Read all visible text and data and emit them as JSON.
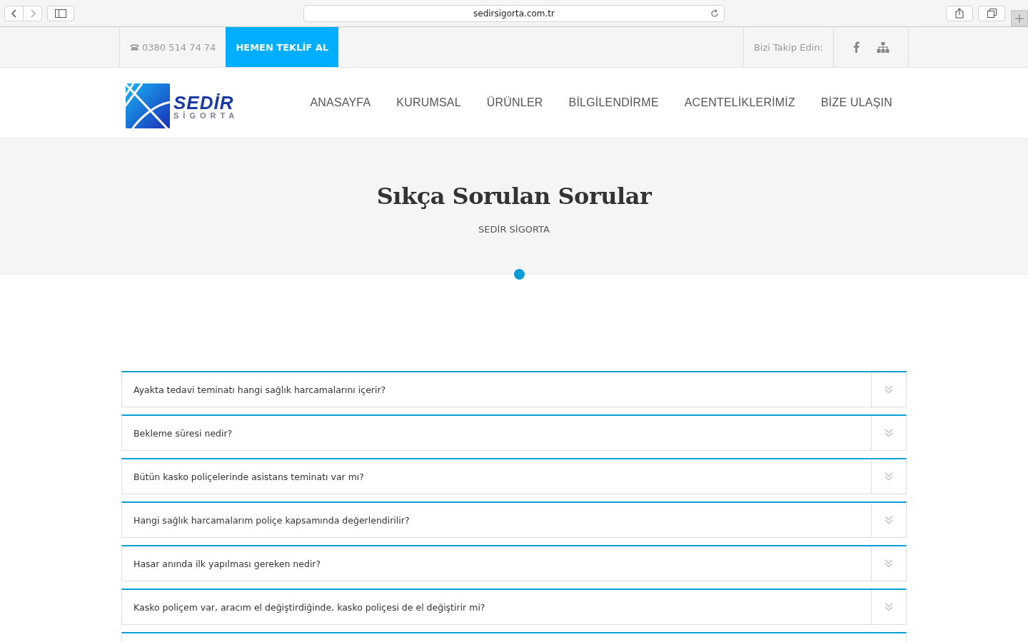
{
  "browser": {
    "url": "sedirsigorta.com.tr"
  },
  "topbar": {
    "phone": "0380 514 74 74",
    "cta": "HEMEN TEKLİF AL",
    "follow": "Bizi Takip Edin:"
  },
  "logo": {
    "name": "SEDİR",
    "tagline": "SİGORTA"
  },
  "nav": [
    {
      "label": "ANASAYFA"
    },
    {
      "label": "KURUMSAL"
    },
    {
      "label": "ÜRÜNLER"
    },
    {
      "label": "BİLGİLENDİRME"
    },
    {
      "label": "ACENTELİKLERİMİZ"
    },
    {
      "label": "BİZE ULAŞIN"
    }
  ],
  "hero": {
    "title": "Sıkça Sorulan Sorular",
    "subtitle": "SEDİR SİGORTA"
  },
  "faqs": [
    {
      "question": "Ayakta tedavi teminatı hangi sağlık harcamalarını içerir?",
      "expanded": false
    },
    {
      "question": "Bekleme süresi nedir?",
      "expanded": false
    },
    {
      "question": "Bütün kasko poliçelerinde asistans teminatı var mı?",
      "expanded": false
    },
    {
      "question": "Hangi sağlık harcamalarım poliçe kapsamında değerlendirilir?",
      "expanded": false
    },
    {
      "question": "Hasar anında ilk yapılması gereken nedir?",
      "expanded": false
    },
    {
      "question": "Kasko poliçem var, aracım el değiştirdiğinde, kasko poliçesi de el değiştirir mi?",
      "expanded": false
    }
  ]
}
